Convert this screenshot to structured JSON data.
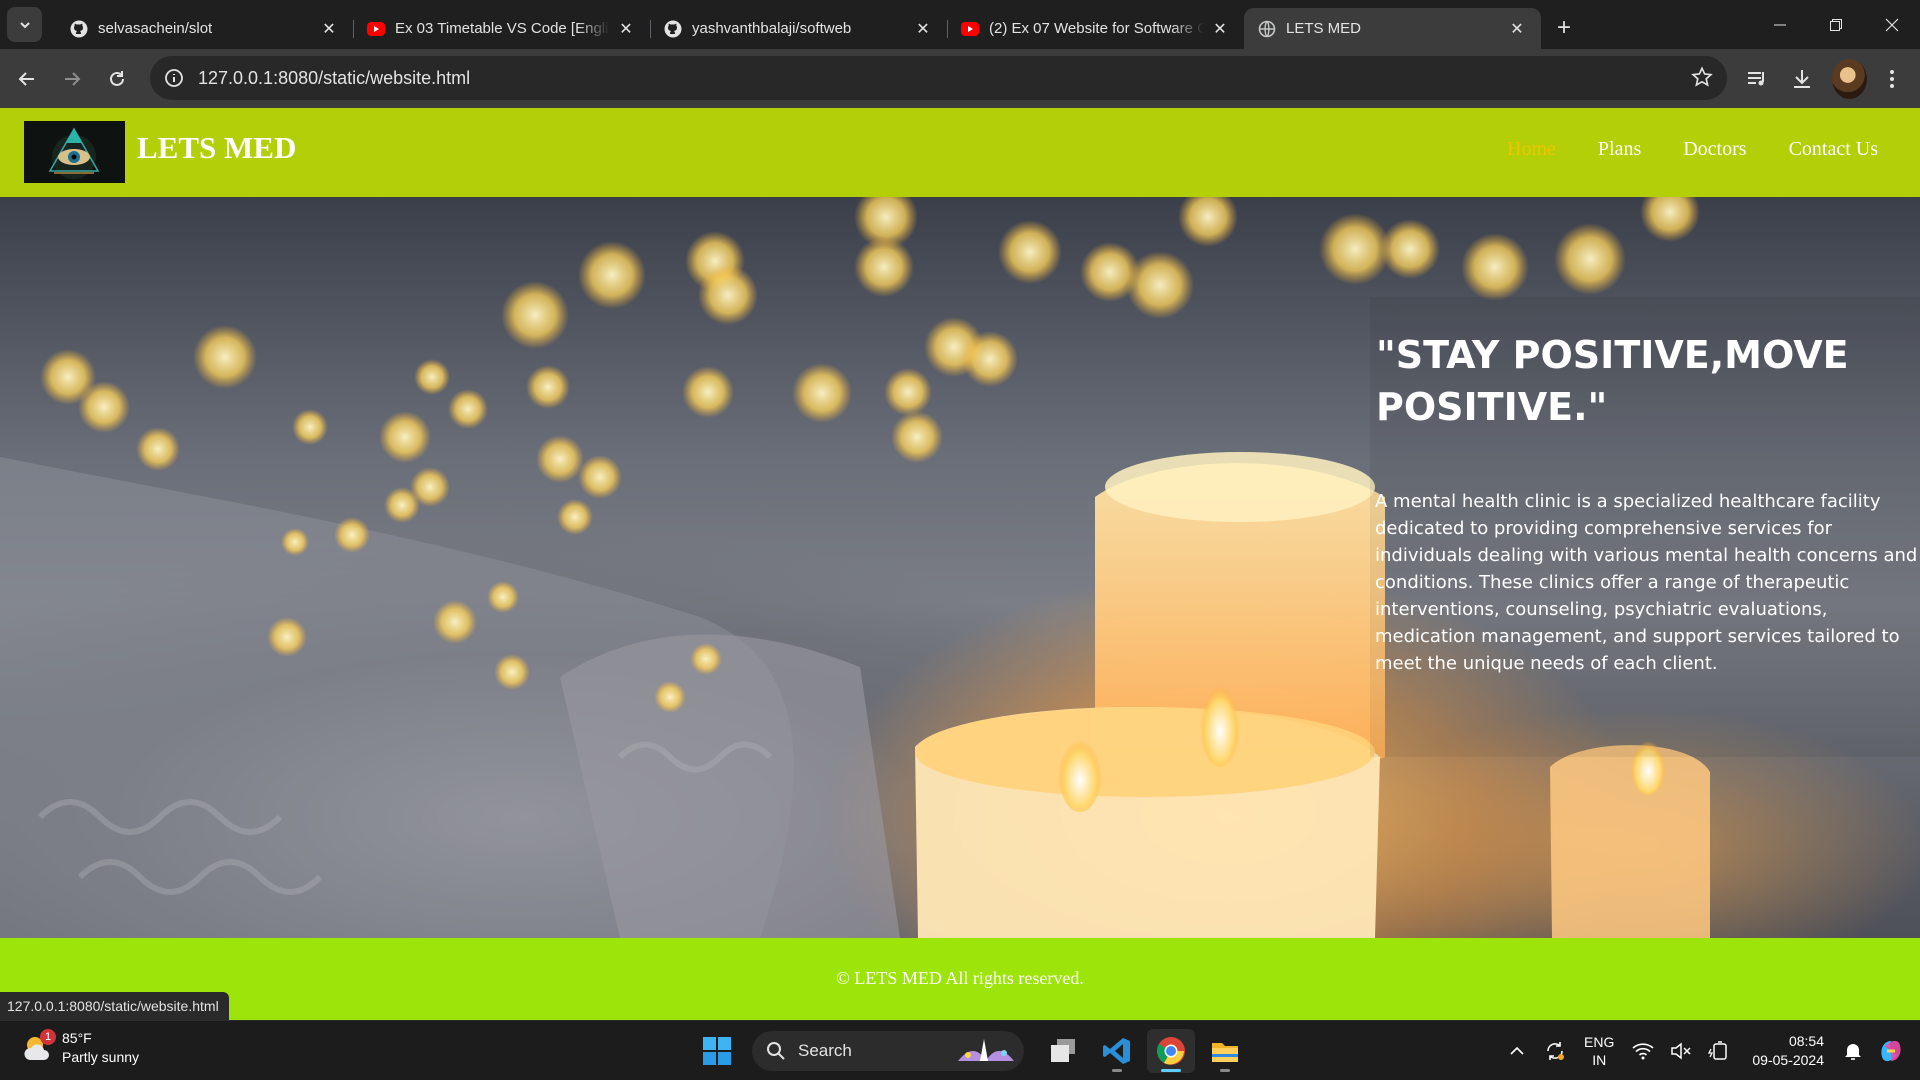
{
  "browser": {
    "tabs": [
      {
        "title": "selvasachein/slot",
        "favicon": "github-icon",
        "active": false
      },
      {
        "title": "Ex 03 Timetable VS Code [English]",
        "favicon": "youtube-icon",
        "active": false
      },
      {
        "title": "yashvanthbalaji/softweb",
        "favicon": "github-icon",
        "active": false
      },
      {
        "title": "(2) Ex 07 Website for Software Company",
        "favicon": "youtube-icon",
        "active": false
      },
      {
        "title": "LETS MED",
        "favicon": "globe-icon",
        "active": true
      }
    ],
    "url": "127.0.0.1:8080/static/website.html",
    "status_url": "127.0.0.1:8080/static/website.html"
  },
  "site": {
    "brand": "LETS MED",
    "nav": [
      {
        "label": "Home",
        "active": true
      },
      {
        "label": "Plans",
        "active": false
      },
      {
        "label": "Doctors",
        "active": false
      },
      {
        "label": "Contact Us",
        "active": false
      }
    ],
    "hero": {
      "quote": "\"STAY POSITIVE,MOVE POSITIVE.\"",
      "description": "A mental health clinic is a specialized healthcare facility dedicated to providing comprehensive services for individuals dealing with various mental health concerns and conditions. These clinics offer a range of therapeutic interventions, counseling, psychiatric evaluations, medication management, and support services tailored to meet the unique needs of each client."
    },
    "footer": "© LETS MED All rights reserved.",
    "colors": {
      "header": "#b2cf07",
      "footer": "#9de40b",
      "active_nav": "#f2c400"
    }
  },
  "taskbar": {
    "weather": {
      "temp": "85°F",
      "condition": "Partly sunny",
      "badge": "1"
    },
    "search_label": "Search",
    "lang_line1": "ENG",
    "lang_line2": "IN",
    "time": "08:54",
    "date": "09-05-2024"
  }
}
